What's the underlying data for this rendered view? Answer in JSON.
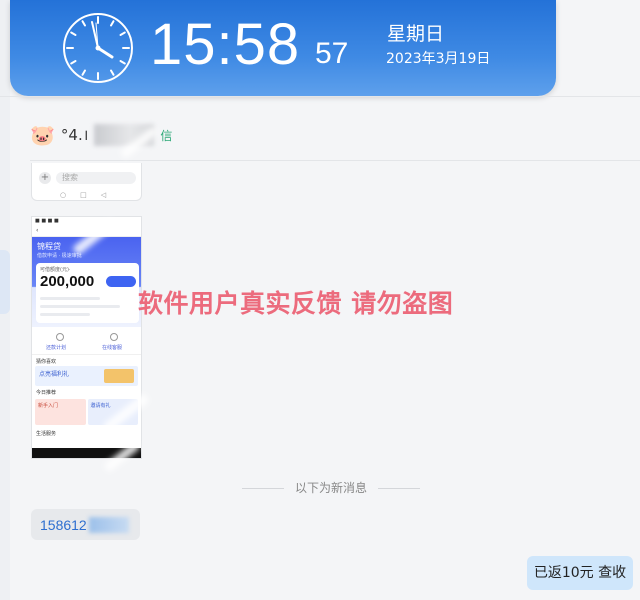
{
  "clock": {
    "time": "15:58",
    "seconds": "57",
    "weekday": "星期日",
    "date": "2023年3月19日"
  },
  "contact": {
    "avatar_emoji": "🐷",
    "name_visible": "°4.।",
    "tag": "信"
  },
  "top_image": {
    "placeholder": "搜索"
  },
  "phone_screenshot": {
    "hero_title": "锦程贷",
    "hero_sub": "借款申请 · 极速审批",
    "card_caption": "可借额度(元)·",
    "amount": "200,000",
    "row_labels": [
      "还款计划",
      "在线客服"
    ],
    "section1": "猜你喜欢",
    "banner_text": "点亮福利礼",
    "section2": "今日推荐",
    "tile1": "新手入门",
    "tile2": "邀请有礼",
    "section3": "生活服务"
  },
  "watermark": "软件用户真实反馈  请勿盗图",
  "separator": {
    "label": "以下为新消息"
  },
  "messages": {
    "left_number": "158612",
    "right_text": "已返10元 查收"
  }
}
